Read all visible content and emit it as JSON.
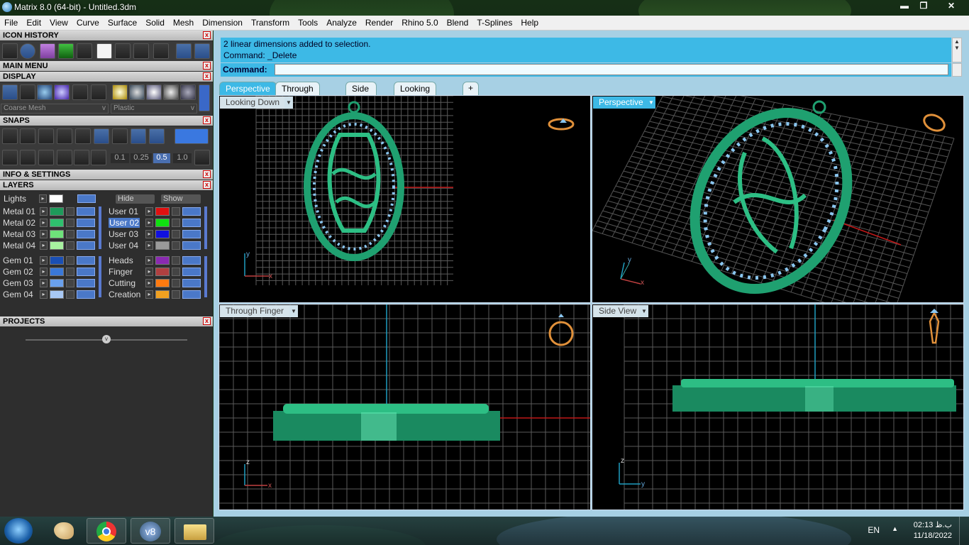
{
  "window": {
    "title": "Matrix 8.0 (64-bit) - Untitled.3dm",
    "minimize": "▬",
    "restore": "❐",
    "close": "✕"
  },
  "menu": [
    "File",
    "Edit",
    "View",
    "Curve",
    "Surface",
    "Solid",
    "Mesh",
    "Dimension",
    "Transform",
    "Tools",
    "Analyze",
    "Render",
    "Rhino 5.0",
    "Blend",
    "T-Splines",
    "Help"
  ],
  "panels": {
    "icon_history": "ICON HISTORY",
    "main_menu": "MAIN MENU",
    "display": "DISPLAY",
    "snaps": "SNAPS",
    "info": "INFO & SETTINGS",
    "layers": "LAYERS",
    "projects": "PROJECTS",
    "close_glyph": "x"
  },
  "display": {
    "mesh_select": "Coarse Mesh",
    "material_select": "Plastic"
  },
  "snaps": {
    "values": [
      "0.1",
      "0.25",
      "0.5",
      "1.0"
    ],
    "active": "0.5"
  },
  "layers": {
    "lights": "Lights",
    "hide_label": "Hide",
    "show_label": "Show",
    "left": [
      {
        "name": "Metal 01",
        "color": "#1e9a5a"
      },
      {
        "name": "Metal 02",
        "color": "#2fbf6e"
      },
      {
        "name": "Metal 03",
        "color": "#6ee27a"
      },
      {
        "name": "Metal 04",
        "color": "#a8f2a0"
      },
      {
        "name": "Gem 01",
        "color": "#1a4fb4"
      },
      {
        "name": "Gem 02",
        "color": "#3a78d8"
      },
      {
        "name": "Gem 03",
        "color": "#6aa0ec"
      },
      {
        "name": "Gem 04",
        "color": "#a8c8f4"
      }
    ],
    "right": [
      {
        "name": "User 01",
        "color": "#e01010"
      },
      {
        "name": "User 02",
        "color": "#10e010",
        "selected": true
      },
      {
        "name": "User 03",
        "color": "#1010e0"
      },
      {
        "name": "User 04",
        "color": "#9a9a9a"
      },
      {
        "name": "Heads",
        "color": "#8a2ab0"
      },
      {
        "name": "Finger",
        "color": "#b04040"
      },
      {
        "name": "Cutting",
        "color": "#ff7a10"
      },
      {
        "name": "Creation",
        "color": "#f0a020"
      }
    ]
  },
  "command": {
    "history": [
      "2 linear dimensions added to selection.",
      "Command: _Delete"
    ],
    "prompt": "Command:",
    "value": ""
  },
  "tabs": [
    {
      "label": "Perspective",
      "active": true
    },
    {
      "label": "Through Finger"
    },
    {
      "label": "Side View"
    },
    {
      "label": "Looking Down"
    },
    {
      "label": "+"
    }
  ],
  "viewports": {
    "tl": "Looking Down",
    "tr": "Perspective",
    "bl": "Through Finger",
    "br": "Side View"
  },
  "axes": {
    "x": "x",
    "y": "y",
    "z": "z"
  },
  "taskbar": {
    "lang": "EN",
    "time": "02:13 ب.ظ",
    "date": "11/18/2022",
    "tray_arrow": "▲",
    "app_v8": "v8"
  },
  "colors": {
    "accent": "#3db9e6",
    "model": "#1fa070",
    "grid": "#5a5a5a"
  }
}
